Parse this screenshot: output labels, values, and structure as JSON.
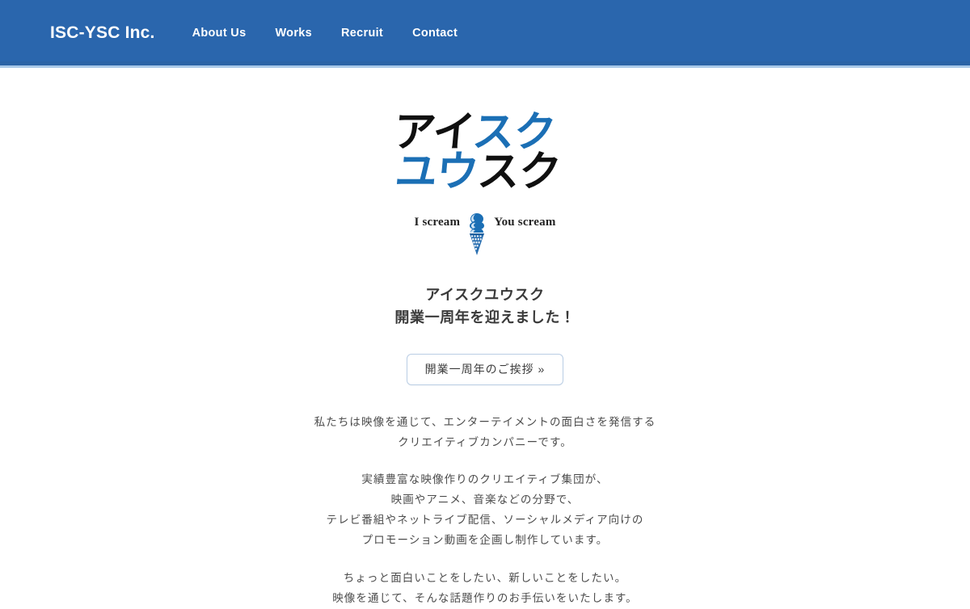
{
  "header": {
    "brand": "ISC-YSC Inc.",
    "nav": [
      {
        "label": "About Us"
      },
      {
        "label": "Works"
      },
      {
        "label": "Recruit"
      },
      {
        "label": "Contact"
      }
    ],
    "background_color": "#2a66ad",
    "border_color": "#a8c8e8",
    "text_color": "#ffffff"
  },
  "logo": {
    "line1": {
      "part_black": "アイ",
      "part_blue": "スク"
    },
    "line2": {
      "part_blue": "ユウ",
      "part_black": "スク"
    },
    "tagline_left": "I scream",
    "tagline_right": "You scream",
    "icon": "ice-cream-cone-icon",
    "color_black": "#101010",
    "color_blue": "#1b6fb5"
  },
  "hero": {
    "headline_line1": "アイスクユウスク",
    "headline_line2": "開業一周年を迎えました！",
    "cta_label": "開業一周年のご挨拶 »"
  },
  "body": {
    "paragraphs": [
      {
        "lines": [
          "私たちは映像を通じて、エンターテイメントの面白さを発信する",
          "クリエイティブカンパニーです。"
        ]
      },
      {
        "lines": [
          "実績豊富な映像作りのクリエイティブ集団が、",
          "映画やアニメ、音楽などの分野で、",
          "テレビ番組やネットライブ配信、ソーシャルメディア向けの",
          "プロモーション動画を企画し制作しています。"
        ]
      },
      {
        "lines": [
          "ちょっと面白いことをしたい、新しいことをしたい。",
          "映像を通じて、そんな話題作りのお手伝いをいたします。"
        ]
      }
    ]
  }
}
